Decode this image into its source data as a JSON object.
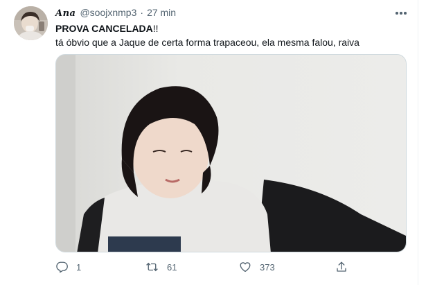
{
  "tweet": {
    "display_name": "Ana",
    "handle": "@soojxnmp3",
    "separator": "·",
    "time": "27 min",
    "text_bold": "PROVA CANCELADA",
    "text_suffix": "!!",
    "text_line2": "tá óbvio que a Jaque de certa forma trapaceou, ela mesma falou, raiva"
  },
  "actions": {
    "reply_count": "1",
    "retweet_count": "61",
    "like_count": "373"
  },
  "icons": {
    "more": "more-dots-icon",
    "reply": "reply-icon",
    "retweet": "retweet-icon",
    "like": "heart-icon",
    "share": "share-icon"
  },
  "colors": {
    "text": "#0f1419",
    "secondary": "#536471",
    "border": "#cfd9de"
  }
}
